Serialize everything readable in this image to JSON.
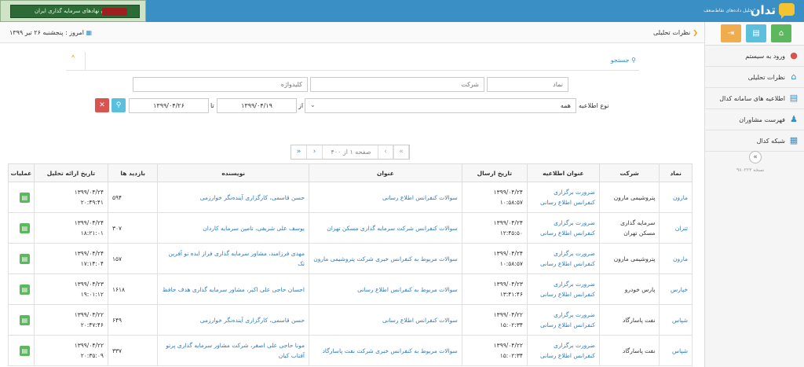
{
  "header": {
    "logo_title": "تدان",
    "logo_subtitle": "تحلیل داده‌های نقاط‌ضعف",
    "banner_text": "کانون نهادهای سرمایه گذاری ایران"
  },
  "breadcrumb": {
    "label": "نظرات تحلیلی"
  },
  "today": {
    "label": "امروز : پنجشنبه ۲۶ تیر ۱۳۹۹"
  },
  "sidebar": {
    "items": [
      {
        "label": "ورود به سیستم",
        "icon": "user-icon"
      },
      {
        "label": "نظرات تحلیلی",
        "icon": "home-icon"
      },
      {
        "label": "اطلاعیه های سامانه کدال",
        "icon": "document-icon"
      },
      {
        "label": "فهرست مشاوران",
        "icon": "users-icon"
      },
      {
        "label": "شبکه کدال",
        "icon": "grid-icon"
      }
    ],
    "version": "نسخه ۹۸۰۲۲۳"
  },
  "search": {
    "toggle_label": "جستجو",
    "symbol_placeholder": "نماد",
    "company_placeholder": "شرکت",
    "keyword_placeholder": "کلیدواژه",
    "type_label": "نوع اطلاعیه",
    "type_value": "همه",
    "from_label": "از",
    "from_value": "۱۳۹۹/۰۴/۱۹",
    "to_label": "تا",
    "to_value": "۱۳۹۹/۰۴/۲۶"
  },
  "pager": {
    "info": "صفحه ۱ از ۴۰۰"
  },
  "table": {
    "headers": [
      "نماد",
      "شرکت",
      "عنوان اطلاعیه",
      "تاریخ ارسال",
      "عنوان",
      "نویسنده",
      "بازدید ها",
      "تاریخ ارائه تحلیل",
      "عملیات"
    ],
    "rows": [
      {
        "symbol": "مارون",
        "company": "پتروشیمی مارون",
        "notice": "ضرورت برگزاری کنفرانس اطلاع رسانی",
        "sent": "۱۳۹۹/۰۴/۲۴\n۱۰:۵۸:۵۷",
        "title": "سوالات کنفرانس اطلاع رسانی",
        "author": "حسن قاسمی، کارگزاری آینده‌نگر خوارزمی",
        "views": "۵۹۴",
        "analysis": "۱۳۹۹/۰۴/۲۴\n۲۰:۴۹:۴۱"
      },
      {
        "symbol": "ثتران",
        "company": "سرمایه گذاری مسکن تهران",
        "notice": "ضرورت برگزاری کنفرانس اطلاع رسانی",
        "sent": "۱۳۹۹/۰۴/۲۴\n۱۲:۴۵:۵۰",
        "title": "سوالات کنفرانس شرکت سرمایه گذاری مسکن تهران",
        "author": "یوسف علی شریفی، تامین سرمایه کاردان",
        "views": "۳۰۷",
        "analysis": "۱۳۹۹/۰۴/۲۴\n۱۸:۲۱:۰۱"
      },
      {
        "symbol": "مارون",
        "company": "پتروشیمی مارون",
        "notice": "ضرورت برگزاری کنفرانس اطلاع رسانی",
        "sent": "۱۳۹۹/۰۴/۲۴\n۱۰:۵۸:۵۷",
        "title": "سوالات مربوط به کنفرانس خبری شرکت پتروشیمی مارون",
        "author": "مهدی فرزامند، مشاور سرمایه گذاری فراز ایده نو آفرین تک",
        "views": "۱۵۷",
        "analysis": "۱۳۹۹/۰۴/۲۴\n۱۷:۱۴:۰۴"
      },
      {
        "symbol": "خپارس",
        "company": "پارس خودرو",
        "notice": "ضرورت برگزاری کنفرانس اطلاع رسانی",
        "sent": "۱۳۹۹/۰۴/۲۳\n۱۳:۴۱:۴۶",
        "title": "سوالات مربوط به کنفرانس اطلاع رسانی",
        "author": "احسان حاجی علی اکبر، مشاور سرمایه گذاری هدف حافظ",
        "views": "۱۶۱۸",
        "analysis": "۱۳۹۹/۰۴/۲۳\n۱۹:۰۱:۱۲"
      },
      {
        "symbol": "شپاس",
        "company": "نفت پاسارگاد",
        "notice": "ضرورت برگزاری کنفرانس اطلاع رسانی",
        "sent": "۱۳۹۹/۰۴/۲۲\n۱۵:۰۲:۳۴",
        "title": "سوالات کنفرانس اطلاع رسانی",
        "author": "حسن قاسمی، کارگزاری آینده‌نگر خوارزمی",
        "views": "۶۴۹",
        "analysis": "۱۳۹۹/۰۴/۲۲\n۲۰:۴۷:۴۶"
      },
      {
        "symbol": "شپاس",
        "company": "نفت پاسارگاد",
        "notice": "ضرورت برگزاری کنفرانس اطلاع رسانی",
        "sent": "۱۳۹۹/۰۴/۲۲\n۱۵:۰۲:۳۴",
        "title": "سوالات مربوط به کنفرانس خبری شرکت نفت پاسارگاد",
        "author": "مونا حاجی علی اصغر، شرکت مشاور سرمایه گذاری پرتو آفتاب کیان",
        "views": "۳۳۷",
        "analysis": "۱۳۹۹/۰۴/۲۲\n۲۰:۳۵:۰۹"
      }
    ]
  },
  "colors": {
    "primary": "#3a8fc4",
    "green": "#5cb85c",
    "orange": "#f39c12",
    "red": "#d9534f"
  }
}
